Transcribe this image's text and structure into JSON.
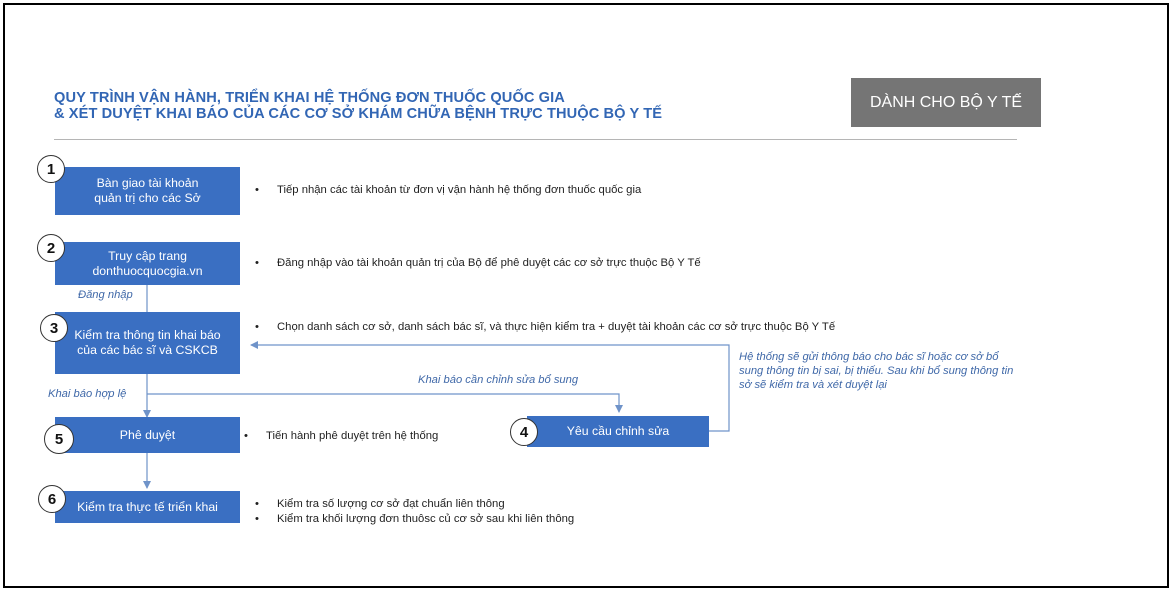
{
  "header": {
    "title_line1": "QUY TRÌNH VẬN HÀNH, TRIỂN KHAI HỆ THỐNG ĐƠN THUỐC QUỐC GIA",
    "title_line2": "& XÉT DUYỆT KHAI BÁO CỦA CÁC CƠ SỞ KHÁM CHỮA BỆNH TRỰC THUỘC BỘ Y TẾ",
    "badge": "DÀNH CHO BỘ Y TẾ"
  },
  "steps": [
    {
      "num": "1",
      "label1": "Bàn giao tài khoản",
      "label2": "quản trị cho các Sở",
      "desc": [
        "Tiếp nhận các tài khoản từ đơn vị vận hành hệ thống đơn thuốc quốc gia"
      ]
    },
    {
      "num": "2",
      "label1": "Truy cập trang",
      "label2": "donthuocquocgia.vn",
      "desc": [
        "Đăng nhập vào tài khoản quản trị của Bộ để phê duyệt các cơ sở trực thuộc Bộ Y Tế"
      ]
    },
    {
      "num": "3",
      "label1": "Kiểm tra thông tin khai báo",
      "label2": "của các bác sĩ và CSKCB",
      "desc": [
        "Chọn danh sách cơ sở, danh sách bác sĩ, và thực hiện kiểm tra + duyệt tài khoản các cơ sở trực thuộc Bộ Y Tế"
      ]
    },
    {
      "num": "4",
      "label1": "Yêu cầu chỉnh sửa",
      "label2": "",
      "desc": []
    },
    {
      "num": "5",
      "label1": "Phê duyệt",
      "label2": "",
      "desc": [
        "Tiến hành phê duyệt trên hệ thống"
      ]
    },
    {
      "num": "6",
      "label1": "Kiểm tra thực tế triển khai",
      "label2": "",
      "desc": [
        "Kiểm tra số lượng cơ sở đạt chuẩn liên thông",
        "Kiểm tra khối lượng đơn thuôsc củ cơ sở sau khi liên thông"
      ]
    }
  ],
  "notes": {
    "login": "Đăng nhập",
    "valid": "Khai báo hợp lệ",
    "needs_edit": "Khai báo cần chỉnh sửa bổ sung",
    "feedback": "Hệ thống sẽ gửi thông báo cho bác sĩ hoặc cơ sở bổ sung thông tin bị sai, bị thiếu. Sau khi bổ sung thông tin sở sẽ kiểm tra và xét duyệt lại"
  },
  "bullet": "•",
  "colors": {
    "box": "#3a6fc2",
    "title": "#3266b4",
    "badge": "#757575",
    "note": "#3f68a8",
    "line": "#6f93c9"
  }
}
